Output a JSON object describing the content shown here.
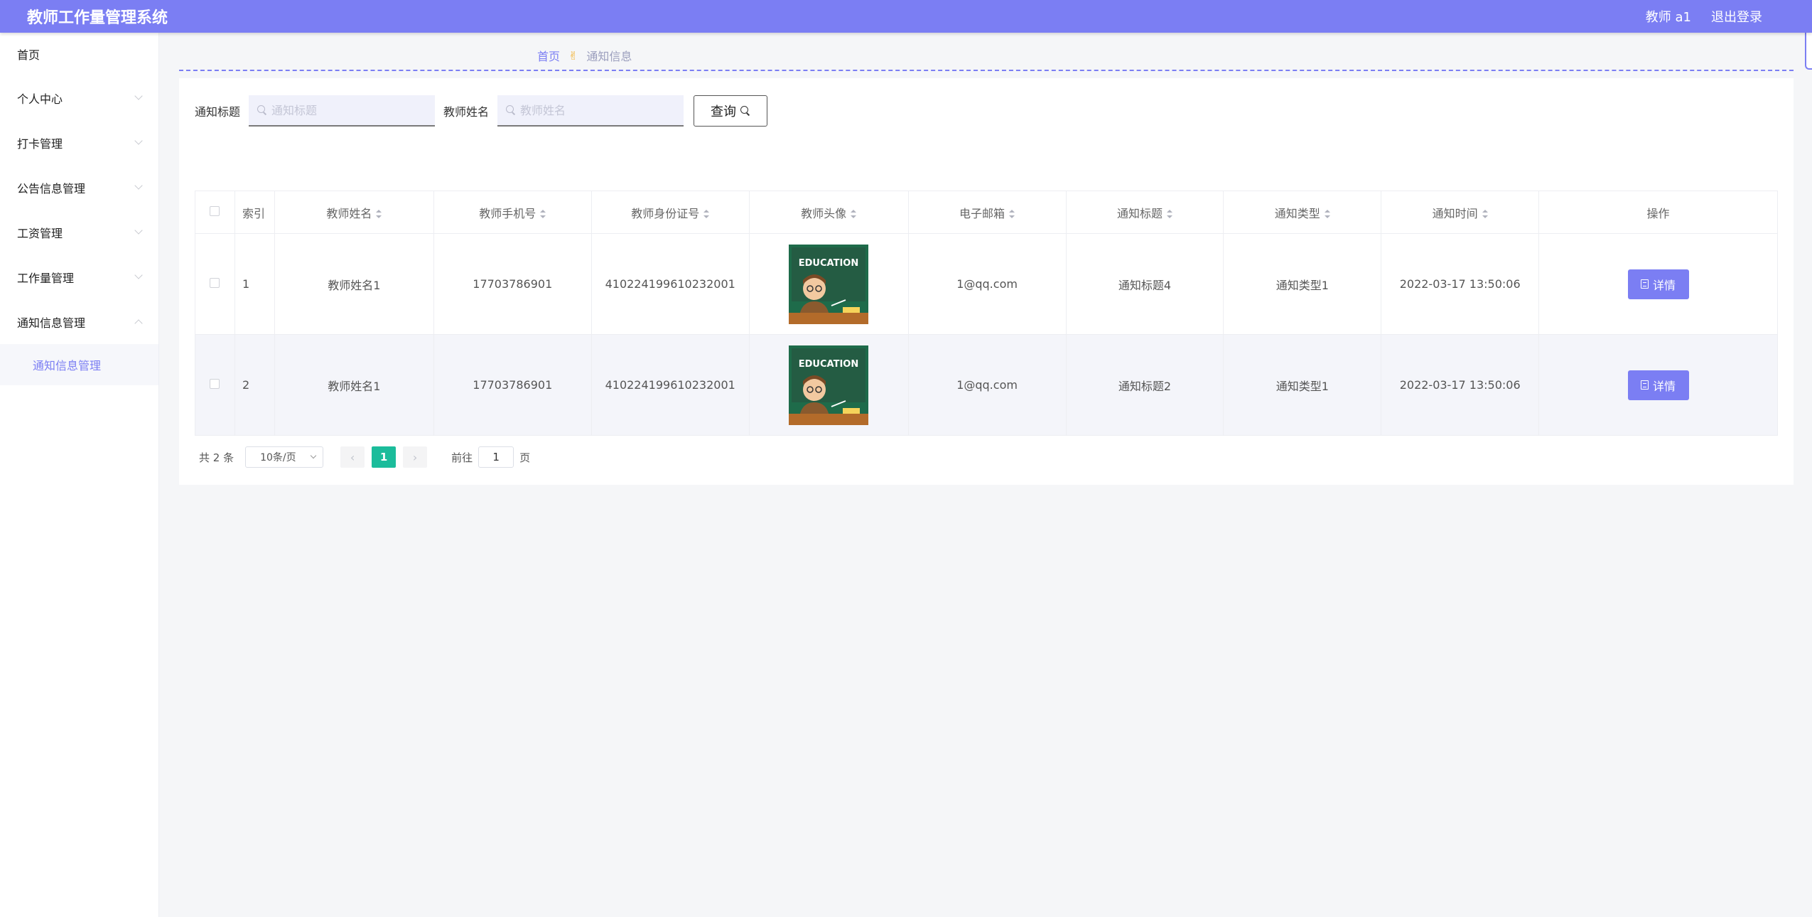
{
  "header": {
    "app_title": "教师工作量管理系统",
    "user": "教师 a1",
    "logout": "退出登录"
  },
  "sidebar": {
    "items": [
      {
        "label": "首页"
      },
      {
        "label": "个人中心"
      },
      {
        "label": "打卡管理"
      },
      {
        "label": "公告信息管理"
      },
      {
        "label": "工资管理"
      },
      {
        "label": "工作量管理"
      },
      {
        "label": "通知信息管理"
      }
    ],
    "sub_item": "通知信息管理"
  },
  "breadcrumb": {
    "home": "首页",
    "separator": "✌",
    "current": "通知信息"
  },
  "search": {
    "title_label": "通知标题",
    "title_placeholder": "通知标题",
    "name_label": "教师姓名",
    "name_placeholder": "教师姓名",
    "query_button": "查询"
  },
  "table": {
    "columns": [
      "索引",
      "教师姓名",
      "教师手机号",
      "教师身份证号",
      "教师头像",
      "电子邮箱",
      "通知标题",
      "通知类型",
      "通知时间",
      "操作"
    ],
    "rows": [
      {
        "index": "1",
        "name": "教师姓名1",
        "phone": "17703786901",
        "id_card": "410224199610232001",
        "email": "1@qq.com",
        "title": "通知标题4",
        "type": "通知类型1",
        "time": "2022-03-17 13:50:06",
        "action": "详情"
      },
      {
        "index": "2",
        "name": "教师姓名1",
        "phone": "17703786901",
        "id_card": "410224199610232001",
        "email": "1@qq.com",
        "title": "通知标题2",
        "type": "通知类型1",
        "time": "2022-03-17 13:50:06",
        "action": "详情"
      }
    ],
    "avatar_text": "EDUCATION"
  },
  "pagination": {
    "total": "共 2 条",
    "page_size": "10条/页",
    "current_page": "1",
    "goto_label": "前往",
    "goto_value": "1",
    "page_suffix": "页"
  },
  "colors": {
    "primary": "#7b7ef3",
    "active_page": "#1bbc9b",
    "avatar_bg": "#1e6b4a"
  }
}
